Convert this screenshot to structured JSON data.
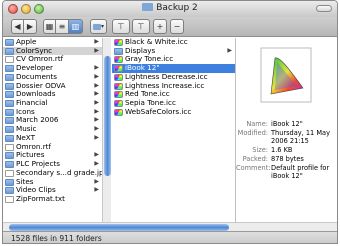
{
  "window": {
    "title": "Backup 2"
  },
  "toolbar": {
    "back_glyph": "◀",
    "forward_glyph": "▶",
    "view_icon": "▥",
    "list_icon": "≡",
    "column_icon": "▥",
    "path_icon": "▾",
    "action1_icon": "⊤",
    "action2_icon": "⊤",
    "add_icon": "+",
    "remove_icon": "−"
  },
  "column1": [
    {
      "label": "Apple",
      "icon": "folder",
      "arrow": "▶"
    },
    {
      "label": "ColorSync",
      "icon": "folder",
      "arrow": "▶",
      "state": "grey"
    },
    {
      "label": "CV Omron.rtf",
      "icon": "doc",
      "arrow": ""
    },
    {
      "label": "Developer",
      "icon": "folder",
      "arrow": "▶"
    },
    {
      "label": "Documents",
      "icon": "folder",
      "arrow": "▶"
    },
    {
      "label": "Dossier ODVA",
      "icon": "folder",
      "arrow": "▶"
    },
    {
      "label": "Downloads",
      "icon": "folder",
      "arrow": "▶"
    },
    {
      "label": "Financial",
      "icon": "folder",
      "arrow": "▶"
    },
    {
      "label": "Icons",
      "icon": "folder",
      "arrow": "▶"
    },
    {
      "label": "March 2006",
      "icon": "folder",
      "arrow": "▶"
    },
    {
      "label": "Music",
      "icon": "folder",
      "arrow": "▶"
    },
    {
      "label": "NeXT",
      "icon": "folder",
      "arrow": "▶"
    },
    {
      "label": "Omron.rtf",
      "icon": "doc",
      "arrow": ""
    },
    {
      "label": "Pictures",
      "icon": "folder",
      "arrow": "▶"
    },
    {
      "label": "PLC Projects",
      "icon": "folder",
      "arrow": "▶"
    },
    {
      "label": "Secondary s...d grade.jpeg",
      "icon": "doc",
      "arrow": ""
    },
    {
      "label": "Sites",
      "icon": "folder",
      "arrow": "▶"
    },
    {
      "label": "Video Clips",
      "icon": "folder",
      "arrow": "▶"
    },
    {
      "label": "ZipFormat.txt",
      "icon": "doc",
      "arrow": ""
    }
  ],
  "column2": [
    {
      "label": "Black & White.icc",
      "icon": "icc"
    },
    {
      "label": "Displays",
      "icon": "folder",
      "arrow": "▶"
    },
    {
      "label": "Gray Tone.icc",
      "icon": "icc"
    },
    {
      "label": "iBook 12\"",
      "icon": "icc",
      "state": "selected"
    },
    {
      "label": "Lightness Decrease.icc",
      "icon": "icc"
    },
    {
      "label": "Lightness Increase.icc",
      "icon": "icc"
    },
    {
      "label": "Red Tone.icc",
      "icon": "icc"
    },
    {
      "label": "Sepia Tone.icc",
      "icon": "icc"
    },
    {
      "label": "WebSafeColors.icc",
      "icon": "icc"
    }
  ],
  "preview": {
    "fields": [
      {
        "key": "Name:",
        "value": "iBook 12\""
      },
      {
        "key": "Modified:",
        "value": "Thursday, 11 May 2006 21:15"
      },
      {
        "key": "Size:",
        "value": "1.6 KB"
      },
      {
        "key": "Packed:",
        "value": "878 bytes"
      },
      {
        "key": "Comment:",
        "value": "Default profile for iBook 12\""
      }
    ]
  },
  "status": {
    "text": "1528 files in 911 folders"
  },
  "colors": {
    "selection": "#3d80df",
    "titlebar_top": "#ececec",
    "titlebar_bottom": "#c9c9c9"
  }
}
